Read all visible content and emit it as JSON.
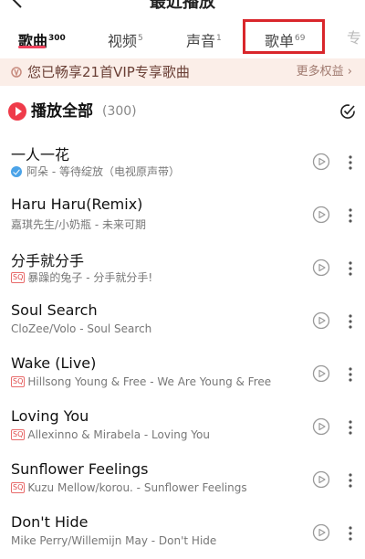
{
  "header": {
    "title": "最近播放"
  },
  "tabs": [
    {
      "label": "歌曲",
      "count": "300"
    },
    {
      "label": "视频",
      "count": "5"
    },
    {
      "label": "声音",
      "count": "1"
    },
    {
      "label": "歌单",
      "count": "69"
    },
    {
      "label": "专"
    }
  ],
  "vip_banner": {
    "text": "您已畅享21首VIP专享歌曲",
    "more": "更多权益 ›"
  },
  "play_all": {
    "label": "播放全部",
    "count": "(300)"
  },
  "songs": [
    {
      "title": "一人一花",
      "subtitle": "阿朵 - 等待绽放（电视原声带）",
      "badge": "verified"
    },
    {
      "title": "Haru Haru(Remix)",
      "subtitle": "嘉琪先生/小奶瓶 - 未来可期",
      "badge": ""
    },
    {
      "title": "分手就分手",
      "subtitle": "暴躁的兔子 - 分手就分手!",
      "badge": "SQ"
    },
    {
      "title": "Soul Search",
      "subtitle": "CloZee/Volo - Soul Search",
      "badge": ""
    },
    {
      "title": "Wake (Live)",
      "subtitle": "Hillsong Young & Free - We Are Young & Free",
      "badge": "SQ"
    },
    {
      "title": "Loving You",
      "subtitle": "Allexinno & Mirabela - Loving You",
      "badge": "SQ"
    },
    {
      "title": "Sunflower Feelings",
      "subtitle": "Kuzu Mellow/korou. - Sunflower Feelings",
      "badge": "SQ"
    },
    {
      "title": "Don't Hide",
      "subtitle": "Mike Perry/Willemijn May - Don't Hide",
      "badge": ""
    }
  ],
  "colors": {
    "accent": "#ef3b4a",
    "highlight_box": "#d9262b",
    "banner_bg": "#fbeee8"
  }
}
